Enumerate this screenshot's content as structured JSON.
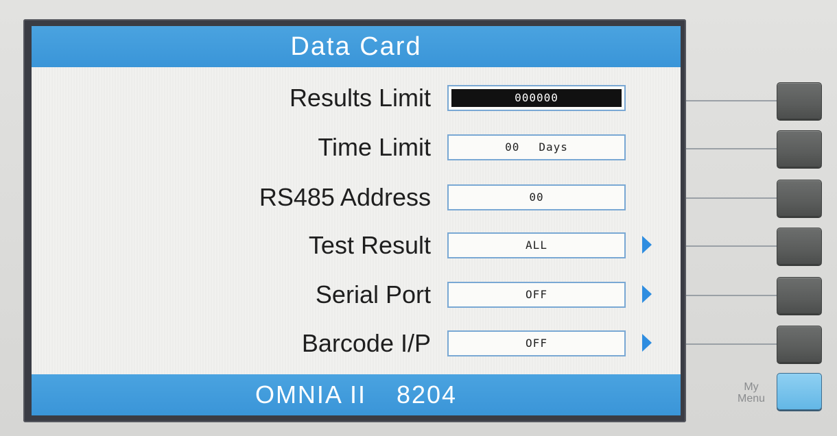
{
  "screen": {
    "title": "Data Card",
    "footer": {
      "model": "OMNIA II",
      "number": "8204"
    }
  },
  "rows": [
    {
      "label": "Results Limit",
      "value": "000000",
      "unit": "",
      "selected": true,
      "has_arrow": false
    },
    {
      "label": "Time Limit",
      "value": "00",
      "unit": "Days",
      "selected": false,
      "has_arrow": false
    },
    {
      "label": "RS485 Address",
      "value": "00",
      "unit": "",
      "selected": false,
      "has_arrow": false
    },
    {
      "label": "Test Result",
      "value": "ALL",
      "unit": "",
      "selected": false,
      "has_arrow": true
    },
    {
      "label": "Serial Port",
      "value": "OFF",
      "unit": "",
      "selected": false,
      "has_arrow": true
    },
    {
      "label": "Barcode I/P",
      "value": "OFF",
      "unit": "",
      "selected": false,
      "has_arrow": true
    }
  ],
  "panel": {
    "my_menu_label_line1": "My",
    "my_menu_label_line2": "Menu"
  },
  "colors": {
    "title_bar": "#3a95d8",
    "arrow": "#2e8de0",
    "my_menu_button": "#63b7e6",
    "softkey": "#5b5d5c"
  }
}
